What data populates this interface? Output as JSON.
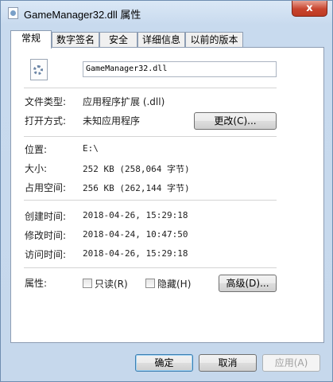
{
  "window": {
    "title": "GameManager32.dll 属性",
    "close_label": "x"
  },
  "tabs": [
    {
      "label": "常规",
      "active": true
    },
    {
      "label": "数字签名"
    },
    {
      "label": "安全"
    },
    {
      "label": "详细信息"
    },
    {
      "label": "以前的版本"
    }
  ],
  "general": {
    "file_name": "GameManager32.dll",
    "file_type_label": "文件类型:",
    "file_type_value": "应用程序扩展 (.dll)",
    "opens_with_label": "打开方式:",
    "opens_with_value": "未知应用程序",
    "change_button": "更改(C)...",
    "location_label": "位置:",
    "location_value": "E:\\",
    "size_label": "大小:",
    "size_value": "252 KB (258,064 字节)",
    "size_on_disk_label": "占用空间:",
    "size_on_disk_value": "256 KB (262,144 字节)",
    "created_label": "创建时间:",
    "created_value": "2018-04-26, 15:29:18",
    "modified_label": "修改时间:",
    "modified_value": "2018-04-24, 10:47:50",
    "accessed_label": "访问时间:",
    "accessed_value": "2018-04-26, 15:29:18",
    "attributes_label": "属性:",
    "readonly_label": "只读(R)",
    "readonly_checked": false,
    "hidden_label": "隐藏(H)",
    "hidden_checked": false,
    "advanced_button": "高级(D)..."
  },
  "buttons": {
    "ok": "确定",
    "cancel": "取消",
    "apply": "应用(A)"
  }
}
